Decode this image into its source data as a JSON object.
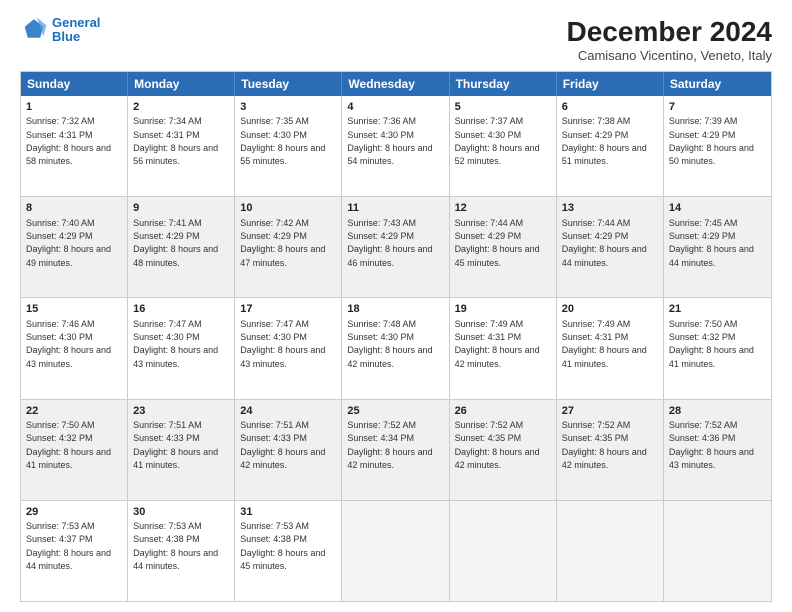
{
  "logo": {
    "line1": "General",
    "line2": "Blue"
  },
  "title": "December 2024",
  "location": "Camisano Vicentino, Veneto, Italy",
  "days_header": [
    "Sunday",
    "Monday",
    "Tuesday",
    "Wednesday",
    "Thursday",
    "Friday",
    "Saturday"
  ],
  "weeks": [
    [
      {
        "day": "1",
        "sunrise": "Sunrise: 7:32 AM",
        "sunset": "Sunset: 4:31 PM",
        "daylight": "Daylight: 8 hours and 58 minutes.",
        "empty": false,
        "shaded": false
      },
      {
        "day": "2",
        "sunrise": "Sunrise: 7:34 AM",
        "sunset": "Sunset: 4:31 PM",
        "daylight": "Daylight: 8 hours and 56 minutes.",
        "empty": false,
        "shaded": false
      },
      {
        "day": "3",
        "sunrise": "Sunrise: 7:35 AM",
        "sunset": "Sunset: 4:30 PM",
        "daylight": "Daylight: 8 hours and 55 minutes.",
        "empty": false,
        "shaded": false
      },
      {
        "day": "4",
        "sunrise": "Sunrise: 7:36 AM",
        "sunset": "Sunset: 4:30 PM",
        "daylight": "Daylight: 8 hours and 54 minutes.",
        "empty": false,
        "shaded": false
      },
      {
        "day": "5",
        "sunrise": "Sunrise: 7:37 AM",
        "sunset": "Sunset: 4:30 PM",
        "daylight": "Daylight: 8 hours and 52 minutes.",
        "empty": false,
        "shaded": false
      },
      {
        "day": "6",
        "sunrise": "Sunrise: 7:38 AM",
        "sunset": "Sunset: 4:29 PM",
        "daylight": "Daylight: 8 hours and 51 minutes.",
        "empty": false,
        "shaded": false
      },
      {
        "day": "7",
        "sunrise": "Sunrise: 7:39 AM",
        "sunset": "Sunset: 4:29 PM",
        "daylight": "Daylight: 8 hours and 50 minutes.",
        "empty": false,
        "shaded": false
      }
    ],
    [
      {
        "day": "8",
        "sunrise": "Sunrise: 7:40 AM",
        "sunset": "Sunset: 4:29 PM",
        "daylight": "Daylight: 8 hours and 49 minutes.",
        "empty": false,
        "shaded": true
      },
      {
        "day": "9",
        "sunrise": "Sunrise: 7:41 AM",
        "sunset": "Sunset: 4:29 PM",
        "daylight": "Daylight: 8 hours and 48 minutes.",
        "empty": false,
        "shaded": true
      },
      {
        "day": "10",
        "sunrise": "Sunrise: 7:42 AM",
        "sunset": "Sunset: 4:29 PM",
        "daylight": "Daylight: 8 hours and 47 minutes.",
        "empty": false,
        "shaded": true
      },
      {
        "day": "11",
        "sunrise": "Sunrise: 7:43 AM",
        "sunset": "Sunset: 4:29 PM",
        "daylight": "Daylight: 8 hours and 46 minutes.",
        "empty": false,
        "shaded": true
      },
      {
        "day": "12",
        "sunrise": "Sunrise: 7:44 AM",
        "sunset": "Sunset: 4:29 PM",
        "daylight": "Daylight: 8 hours and 45 minutes.",
        "empty": false,
        "shaded": true
      },
      {
        "day": "13",
        "sunrise": "Sunrise: 7:44 AM",
        "sunset": "Sunset: 4:29 PM",
        "daylight": "Daylight: 8 hours and 44 minutes.",
        "empty": false,
        "shaded": true
      },
      {
        "day": "14",
        "sunrise": "Sunrise: 7:45 AM",
        "sunset": "Sunset: 4:29 PM",
        "daylight": "Daylight: 8 hours and 44 minutes.",
        "empty": false,
        "shaded": true
      }
    ],
    [
      {
        "day": "15",
        "sunrise": "Sunrise: 7:46 AM",
        "sunset": "Sunset: 4:30 PM",
        "daylight": "Daylight: 8 hours and 43 minutes.",
        "empty": false,
        "shaded": false
      },
      {
        "day": "16",
        "sunrise": "Sunrise: 7:47 AM",
        "sunset": "Sunset: 4:30 PM",
        "daylight": "Daylight: 8 hours and 43 minutes.",
        "empty": false,
        "shaded": false
      },
      {
        "day": "17",
        "sunrise": "Sunrise: 7:47 AM",
        "sunset": "Sunset: 4:30 PM",
        "daylight": "Daylight: 8 hours and 43 minutes.",
        "empty": false,
        "shaded": false
      },
      {
        "day": "18",
        "sunrise": "Sunrise: 7:48 AM",
        "sunset": "Sunset: 4:30 PM",
        "daylight": "Daylight: 8 hours and 42 minutes.",
        "empty": false,
        "shaded": false
      },
      {
        "day": "19",
        "sunrise": "Sunrise: 7:49 AM",
        "sunset": "Sunset: 4:31 PM",
        "daylight": "Daylight: 8 hours and 42 minutes.",
        "empty": false,
        "shaded": false
      },
      {
        "day": "20",
        "sunrise": "Sunrise: 7:49 AM",
        "sunset": "Sunset: 4:31 PM",
        "daylight": "Daylight: 8 hours and 41 minutes.",
        "empty": false,
        "shaded": false
      },
      {
        "day": "21",
        "sunrise": "Sunrise: 7:50 AM",
        "sunset": "Sunset: 4:32 PM",
        "daylight": "Daylight: 8 hours and 41 minutes.",
        "empty": false,
        "shaded": false
      }
    ],
    [
      {
        "day": "22",
        "sunrise": "Sunrise: 7:50 AM",
        "sunset": "Sunset: 4:32 PM",
        "daylight": "Daylight: 8 hours and 41 minutes.",
        "empty": false,
        "shaded": true
      },
      {
        "day": "23",
        "sunrise": "Sunrise: 7:51 AM",
        "sunset": "Sunset: 4:33 PM",
        "daylight": "Daylight: 8 hours and 41 minutes.",
        "empty": false,
        "shaded": true
      },
      {
        "day": "24",
        "sunrise": "Sunrise: 7:51 AM",
        "sunset": "Sunset: 4:33 PM",
        "daylight": "Daylight: 8 hours and 42 minutes.",
        "empty": false,
        "shaded": true
      },
      {
        "day": "25",
        "sunrise": "Sunrise: 7:52 AM",
        "sunset": "Sunset: 4:34 PM",
        "daylight": "Daylight: 8 hours and 42 minutes.",
        "empty": false,
        "shaded": true
      },
      {
        "day": "26",
        "sunrise": "Sunrise: 7:52 AM",
        "sunset": "Sunset: 4:35 PM",
        "daylight": "Daylight: 8 hours and 42 minutes.",
        "empty": false,
        "shaded": true
      },
      {
        "day": "27",
        "sunrise": "Sunrise: 7:52 AM",
        "sunset": "Sunset: 4:35 PM",
        "daylight": "Daylight: 8 hours and 42 minutes.",
        "empty": false,
        "shaded": true
      },
      {
        "day": "28",
        "sunrise": "Sunrise: 7:52 AM",
        "sunset": "Sunset: 4:36 PM",
        "daylight": "Daylight: 8 hours and 43 minutes.",
        "empty": false,
        "shaded": true
      }
    ],
    [
      {
        "day": "29",
        "sunrise": "Sunrise: 7:53 AM",
        "sunset": "Sunset: 4:37 PM",
        "daylight": "Daylight: 8 hours and 44 minutes.",
        "empty": false,
        "shaded": false
      },
      {
        "day": "30",
        "sunrise": "Sunrise: 7:53 AM",
        "sunset": "Sunset: 4:38 PM",
        "daylight": "Daylight: 8 hours and 44 minutes.",
        "empty": false,
        "shaded": false
      },
      {
        "day": "31",
        "sunrise": "Sunrise: 7:53 AM",
        "sunset": "Sunset: 4:38 PM",
        "daylight": "Daylight: 8 hours and 45 minutes.",
        "empty": false,
        "shaded": false
      },
      {
        "day": "",
        "sunrise": "",
        "sunset": "",
        "daylight": "",
        "empty": true,
        "shaded": false
      },
      {
        "day": "",
        "sunrise": "",
        "sunset": "",
        "daylight": "",
        "empty": true,
        "shaded": false
      },
      {
        "day": "",
        "sunrise": "",
        "sunset": "",
        "daylight": "",
        "empty": true,
        "shaded": false
      },
      {
        "day": "",
        "sunrise": "",
        "sunset": "",
        "daylight": "",
        "empty": true,
        "shaded": false
      }
    ]
  ]
}
